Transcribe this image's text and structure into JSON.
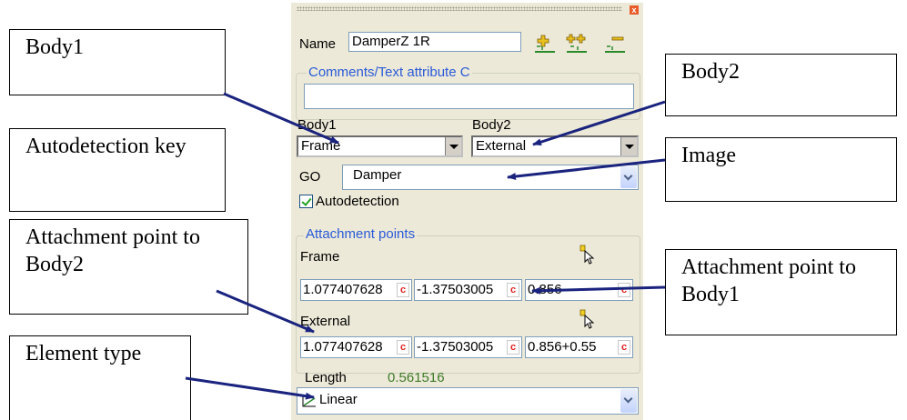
{
  "dialog": {
    "name_label": "Name",
    "name_value": "DamperZ 1R",
    "comments_group_label": "Comments/Text attribute C",
    "comments_value": "",
    "body1_label": "Body1",
    "body1_value": "Frame",
    "body2_label": "Body2",
    "body2_value": "External",
    "go_label": "GO",
    "go_value": "Damper",
    "autodetection_label": "Autodetection",
    "autodetection_checked": true,
    "attachment_group_label": "Attachment points",
    "frame_label": "Frame",
    "frame_values": [
      "1.077407628",
      "-1.37503005",
      "0.856"
    ],
    "external_label": "External",
    "external_values": [
      "1.077407628",
      "-1.37503005",
      "0.856+0.55"
    ],
    "c_button_label": "c",
    "length_label": "Length",
    "length_value": "0.561516",
    "element_type_value": "Linear",
    "close_label": "x"
  },
  "callouts": {
    "body1": "Body1",
    "autodetection_key": "Autodetection key",
    "attachment_body2": "Attachment point to Body2",
    "element_type": "Element type",
    "body2": "Body2",
    "image": "Image",
    "attachment_body1": "Attachment point to Body1"
  },
  "colors": {
    "panel_bg": "#ece9d8",
    "group_label": "#2a5ad8",
    "length_value": "#3f7a28",
    "arrow": "#1a237e",
    "c_button": "#e02020"
  }
}
